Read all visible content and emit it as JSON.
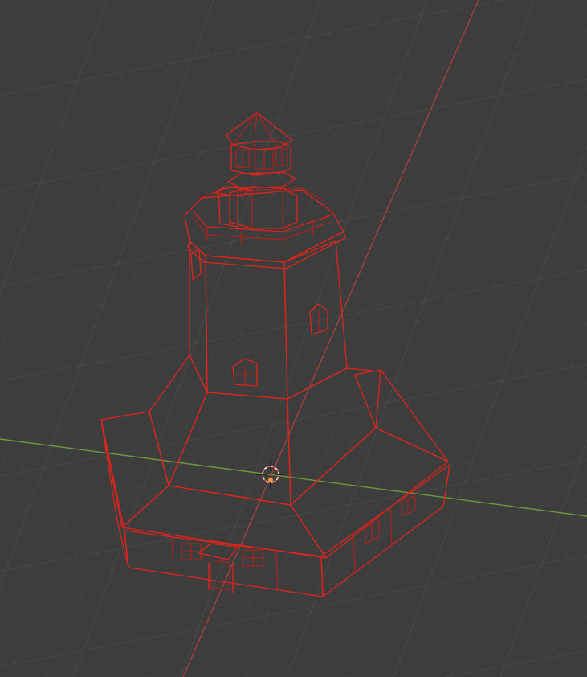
{
  "viewport": {
    "background": "#3d3d3d",
    "grid_minor_color": "#474747",
    "grid_major_color": "#525252",
    "x_axis_color": "#6e9a3a",
    "y_axis_color": "#b3413e",
    "selection_outline_color": "#e0241b",
    "mesh_face_color": "#9b8e86"
  },
  "scene": {
    "object": "lighthouse-mesh",
    "selected": true,
    "cursor": "3d-cursor-icon"
  }
}
